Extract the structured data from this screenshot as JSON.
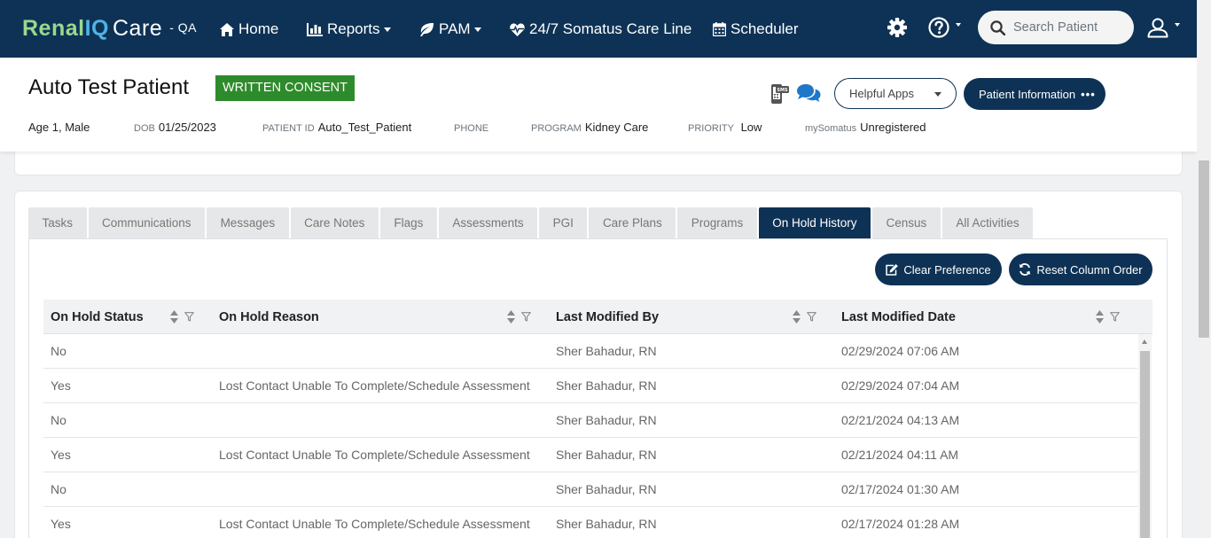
{
  "app": {
    "brand_renal": "Renal",
    "brand_iq": "IQ",
    "brand_care": "Care",
    "env": "- QA"
  },
  "nav": {
    "home": "Home",
    "reports": "Reports",
    "pam": "PAM",
    "care_line": "24/7 Somatus Care Line",
    "scheduler": "Scheduler"
  },
  "search": {
    "placeholder": "Search Patient"
  },
  "patient": {
    "name": "Auto Test Patient",
    "consent": "WRITTEN CONSENT",
    "age_sex": "Age 1, Male",
    "dob_label": "DOB",
    "dob": "01/25/2023",
    "id_label": "PATIENT ID",
    "id": "Auto_Test_Patient",
    "phone_label": "PHONE",
    "phone": "",
    "program_label": "PROGRAM",
    "program": "Kidney Care",
    "priority_label": "PRIORITY",
    "priority": "Low",
    "mysomatus_label": "mySomatus",
    "mysomatus": "Unregistered"
  },
  "actions": {
    "helpful_apps": "Helpful Apps",
    "patient_info": "Patient Information",
    "patient_info_dots": "•••"
  },
  "tabs": [
    {
      "label": "Tasks"
    },
    {
      "label": "Communications"
    },
    {
      "label": "Messages"
    },
    {
      "label": "Care Notes"
    },
    {
      "label": "Flags"
    },
    {
      "label": "Assessments"
    },
    {
      "label": "PGI"
    },
    {
      "label": "Care Plans"
    },
    {
      "label": "Programs"
    },
    {
      "label": "On Hold History"
    },
    {
      "label": "Census"
    },
    {
      "label": "All Activities"
    }
  ],
  "active_tab": "On Hold History",
  "toolbar": {
    "clear_preference": "Clear Preference",
    "reset_column_order": "Reset Column Order"
  },
  "table": {
    "columns": [
      "On Hold Status",
      "On Hold Reason",
      "Last Modified By",
      "Last Modified Date"
    ],
    "rows": [
      [
        "No",
        "",
        "Sher Bahadur, RN",
        "02/29/2024 07:06 AM"
      ],
      [
        "Yes",
        "Lost Contact Unable To Complete/Schedule Assessment",
        "Sher Bahadur, RN",
        "02/29/2024 07:04 AM"
      ],
      [
        "No",
        "",
        "Sher Bahadur, RN",
        "02/21/2024 04:13 AM"
      ],
      [
        "Yes",
        "Lost Contact Unable To Complete/Schedule Assessment",
        "Sher Bahadur, RN",
        "02/21/2024 04:11 AM"
      ],
      [
        "No",
        "",
        "Sher Bahadur, RN",
        "02/17/2024 01:30 AM"
      ],
      [
        "Yes",
        "Lost Contact Unable To Complete/Schedule Assessment",
        "Sher Bahadur, RN",
        "02/17/2024 01:28 AM"
      ]
    ]
  },
  "colors": {
    "navy": "#0e3255",
    "consent_green": "#2e8b2b",
    "brand_green": "#9ad88d",
    "brand_blue": "#4fb3e6"
  }
}
